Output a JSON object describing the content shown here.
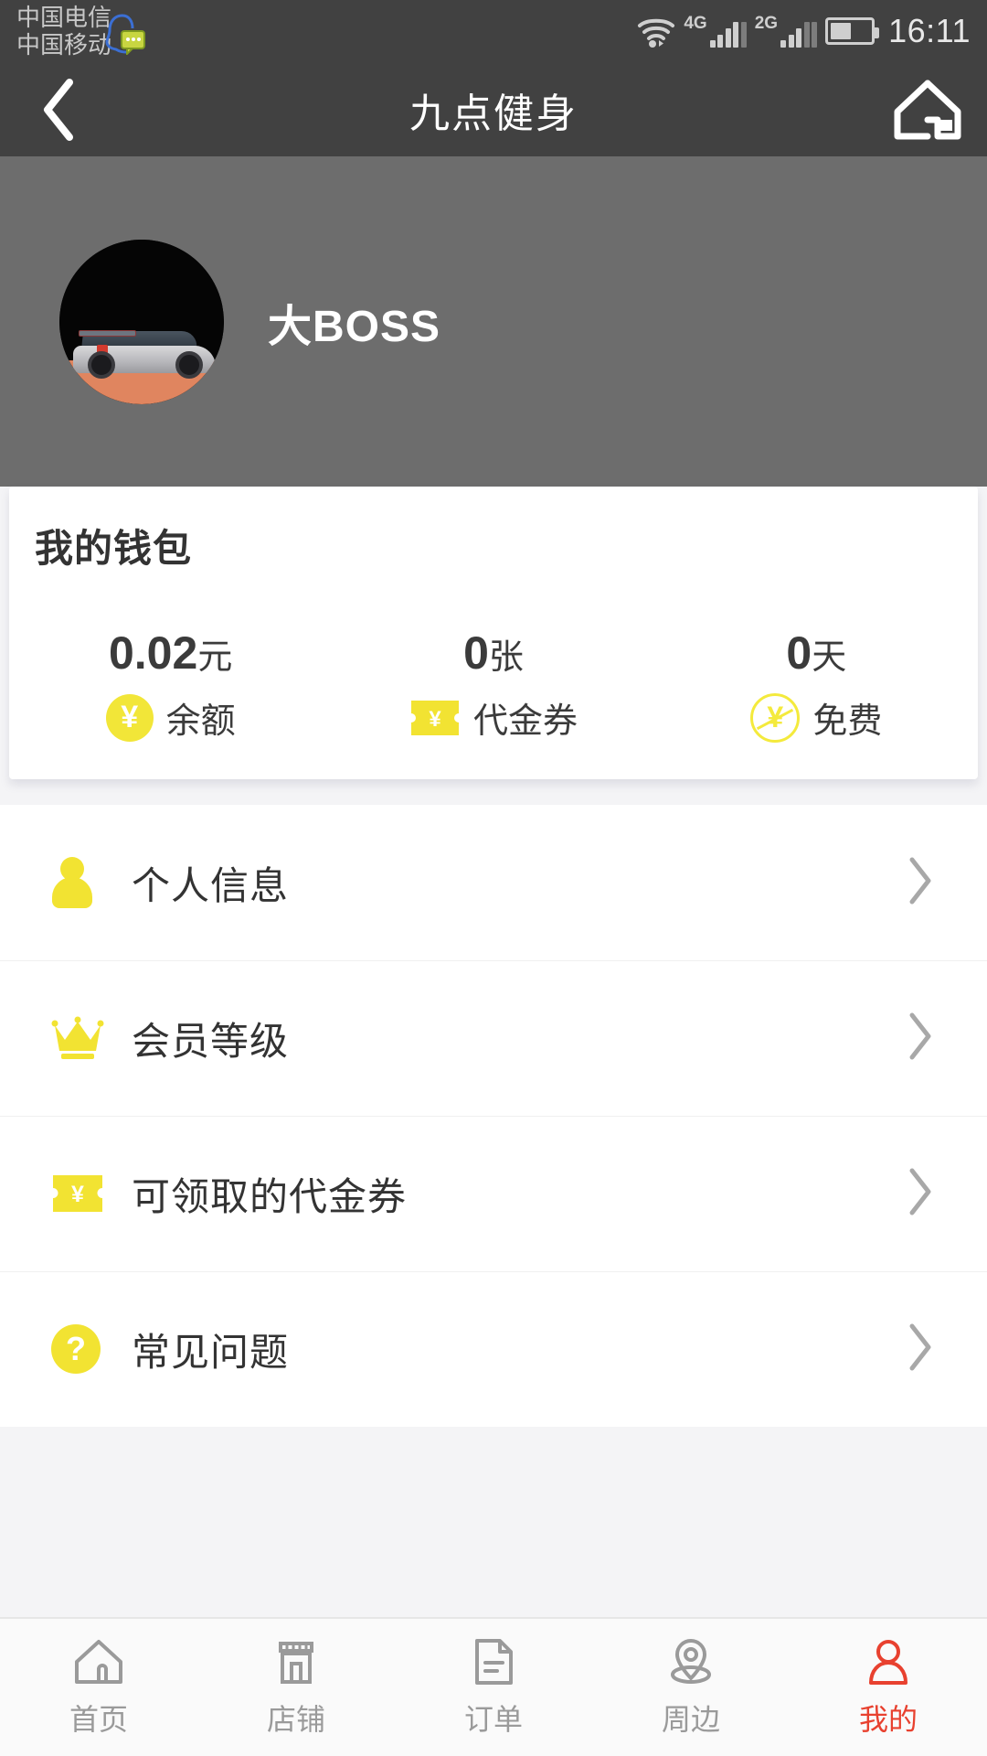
{
  "status_bar": {
    "carrier_line1": "中国电信",
    "carrier_line2": "中国移动",
    "qq_icon": "qq-message-icon",
    "wifi_icon": "wifi-icon",
    "network_1": "4G",
    "network_2": "2G",
    "battery_icon": "battery-icon",
    "time": "16:11"
  },
  "header": {
    "back_icon": "back-chevron-icon",
    "title": "九点健身",
    "home_icon": "home-icon"
  },
  "profile": {
    "avatar_icon": "user-avatar-car-image",
    "name": "大BOSS"
  },
  "wallet": {
    "title": "我的钱包",
    "stats": [
      {
        "value": "0.02",
        "unit": "元",
        "icon": "yen-coin-icon",
        "label": "余额"
      },
      {
        "value": "0",
        "unit": "张",
        "icon": "voucher-ticket-icon",
        "label": "代金券"
      },
      {
        "value": "0",
        "unit": "天",
        "icon": "free-yen-icon",
        "label": "免费"
      }
    ]
  },
  "menu": {
    "items": [
      {
        "label": "个人信息",
        "icon": "person-icon",
        "arrow": "chevron-right-icon"
      },
      {
        "label": "会员等级",
        "icon": "crown-icon",
        "arrow": "chevron-right-icon"
      },
      {
        "label": "可领取的代金券",
        "icon": "voucher-ticket-icon",
        "arrow": "chevron-right-icon"
      },
      {
        "label": "常见问题",
        "icon": "question-mark-icon",
        "arrow": "chevron-right-icon"
      }
    ]
  },
  "tabbar": {
    "items": [
      {
        "label": "首页",
        "icon": "home-icon",
        "active": false
      },
      {
        "label": "店铺",
        "icon": "shop-icon",
        "active": false
      },
      {
        "label": "订单",
        "icon": "document-icon",
        "active": false
      },
      {
        "label": "周边",
        "icon": "location-pin-icon",
        "active": false
      },
      {
        "label": "我的",
        "icon": "user-profile-icon",
        "active": true
      }
    ]
  },
  "colors": {
    "accent_yellow": "#f2e332",
    "active_red": "#e8412f",
    "header_gray": "#414141",
    "profile_gray": "#6d6d6d"
  }
}
